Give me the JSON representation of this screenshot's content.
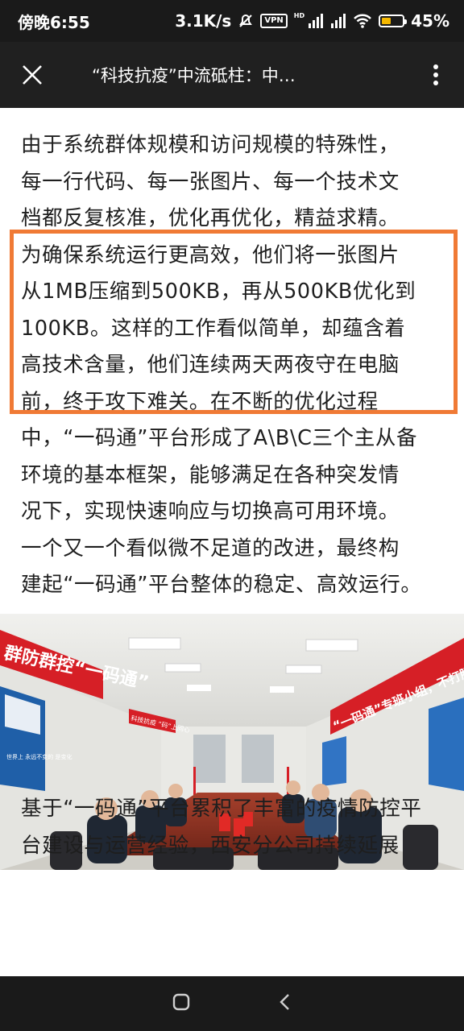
{
  "status": {
    "time": "傍晚6:55",
    "speed": "3.1K/s",
    "vpn": "VPN",
    "hd": "HD",
    "battery": "45%",
    "battery_level": 0.45
  },
  "nav": {
    "title": "“科技抗疫”中流砥柱：中…"
  },
  "article": {
    "para1_lines": [
      "由于系统群体规模和访问规模的特殊性，",
      "每一行代码、每一张图片、每一个技术文",
      "档都反复核准，优化再优化，精益求精。",
      "为确保系统运行更高效，他们将一张图片",
      "从1MB压缩到500KB，再从500KB优化到",
      "100KB。这样的工作看似简单，却蕴含着",
      "高技术含量，他们连续两天两夜守在电脑",
      "前，终于攻下难关。在不断的优化过程",
      "中，“一码通”平台形成了A\\B\\C三个主从备",
      "环境的基本框架，能够满足在各种突发情",
      "况下，实现快速响应与切换高可用环境。",
      "一个又一个看似微不足道的改进，最终构",
      "建起“一码通”平台整体的稳定、高效运行。"
    ],
    "photo": {
      "banner_left": "群防群控“一码通”",
      "banner_right": "“一码通”专班小组，不打胜仗不收兵！",
      "small_banner": "科技抗疫 “码”上同心",
      "poster_text": "世界上 永远不变的 是变化"
    },
    "para2_lines": [
      "基于“一码通”平台累积了丰富的疫情防控平",
      "台建设与运营经验，西安分公司持续延展"
    ]
  },
  "colors": {
    "highlight": "#f07a35",
    "banner_red": "#d61f26"
  }
}
